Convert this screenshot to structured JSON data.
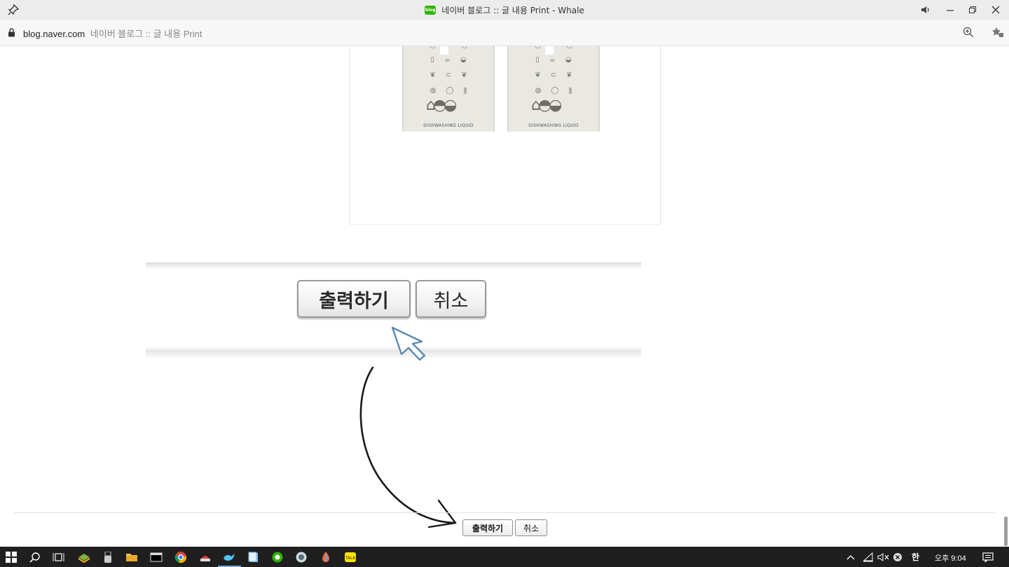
{
  "window": {
    "title": "네이버 블로그 :: 글 내용 Print - Whale",
    "favicon_label": "blog"
  },
  "addressbar": {
    "domain": "blog.naver.com",
    "page_title": "네이버 블로그 :: 글 내용 Print"
  },
  "products": [
    {
      "caption": "DISHWASHING LIQUID"
    },
    {
      "caption": "DISHWASHING LIQUID"
    }
  ],
  "zoomed_dialog": {
    "print_label": "출력하기",
    "cancel_label": "취소"
  },
  "dialog": {
    "print_label": "출력하기",
    "cancel_label": "취소"
  },
  "taskbar": {
    "ime_label": "한",
    "clock": "오후 9:04",
    "pinned": [
      "start-icon",
      "search-icon",
      "task-view-icon",
      "app-icon",
      "usb-icon",
      "file-explorer-icon",
      "terminal-icon",
      "chrome-icon",
      "app-icon",
      "whale-icon",
      "notes-icon",
      "app-icon",
      "app-icon",
      "paint-icon",
      "kakaotalk-icon"
    ]
  },
  "colors": {
    "titlebar_bg": "#ececec",
    "taskbar_bg": "#1f1f1f",
    "blog_green": "#2db400",
    "cursor_blue": "#5b8ab5"
  }
}
